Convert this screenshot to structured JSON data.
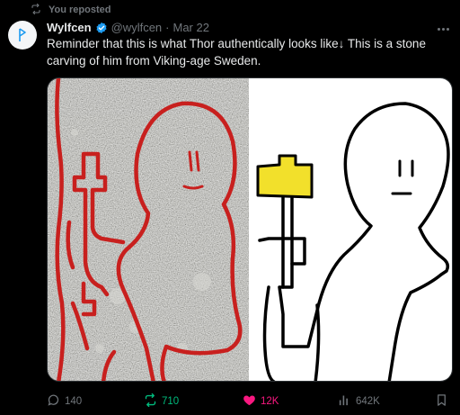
{
  "repost": {
    "label": "You reposted"
  },
  "author": {
    "name": "Wylfcen",
    "handle": "@wylfcen",
    "separator": "·",
    "date": "Mar 22"
  },
  "tweet": {
    "text": "Reminder that this is what Thor authentically looks like↓ This is a stone carving of him from Viking-age Sweden."
  },
  "media": {
    "left_panel": "stone-carving-photo",
    "right_panel": "drawing-of-thor-with-hammer"
  },
  "actions": {
    "replies": "140",
    "reposts": "710",
    "likes": "12K",
    "views": "642K"
  },
  "colors": {
    "retweet": "#00ba7c",
    "like": "#f91880",
    "muted": "#71767b",
    "verified": "#1d9bf0",
    "hammer": "#f2e02b"
  },
  "icons": [
    "repost-icon",
    "verified-badge-icon",
    "more-icon",
    "reply-icon",
    "retweet-icon",
    "heart-icon",
    "views-icon",
    "bookmark-icon"
  ]
}
